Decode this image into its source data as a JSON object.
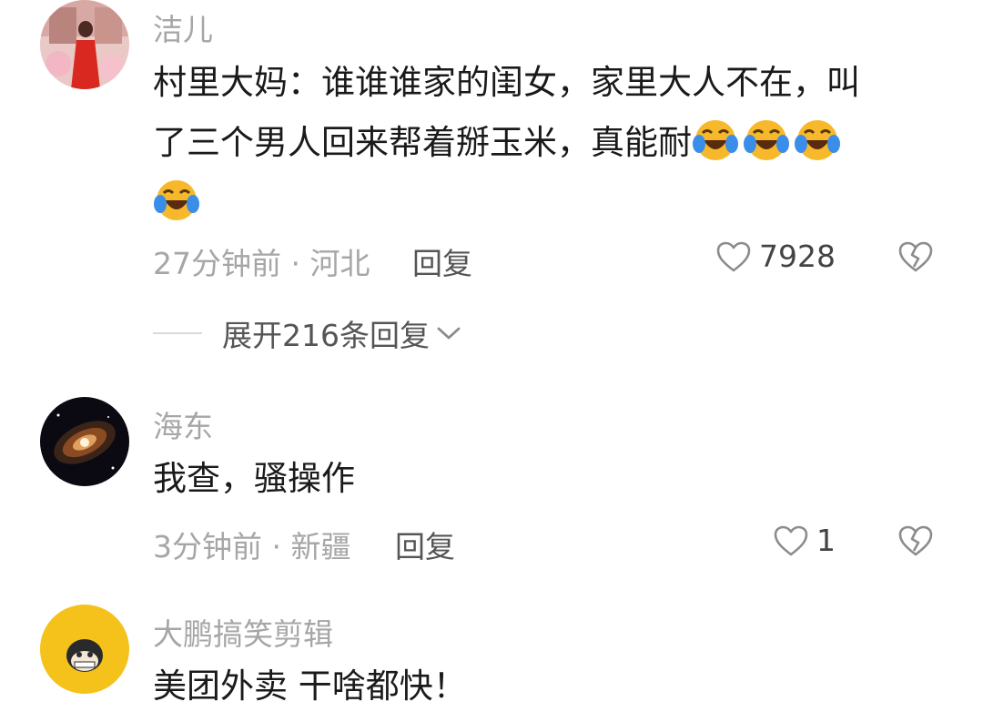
{
  "comments": [
    {
      "username": "洁儿",
      "text_line1": "村里大妈：谁谁谁家的闺女，家里大人不在，叫",
      "text_line2": "了三个男人回来帮着掰玉米，真能耐",
      "time_location": "27分钟前 · 河北",
      "reply_label": "回复",
      "like_count": "7928",
      "emojis": [
        "laugh-cry-emoji",
        "laugh-cry-emoji",
        "laugh-cry-emoji",
        "laugh-cry-emoji"
      ],
      "expand_label": "展开216条回复"
    },
    {
      "username": "海东",
      "text": "我查，骚操作",
      "time_location": "3分钟前 · 新疆",
      "reply_label": "回复",
      "like_count": "1"
    },
    {
      "username": "大鹏搞笑剪辑",
      "text": "美团外卖 干啥都快！"
    }
  ],
  "icons": {
    "like": "heart-outline-icon",
    "dislike": "broken-heart-icon",
    "expand": "chevron-down-icon"
  },
  "colors": {
    "text": "#1a1a1a",
    "muted": "#a6a6a6",
    "emoji_face": "#f7b92b",
    "emoji_tear": "#3a8de8"
  }
}
